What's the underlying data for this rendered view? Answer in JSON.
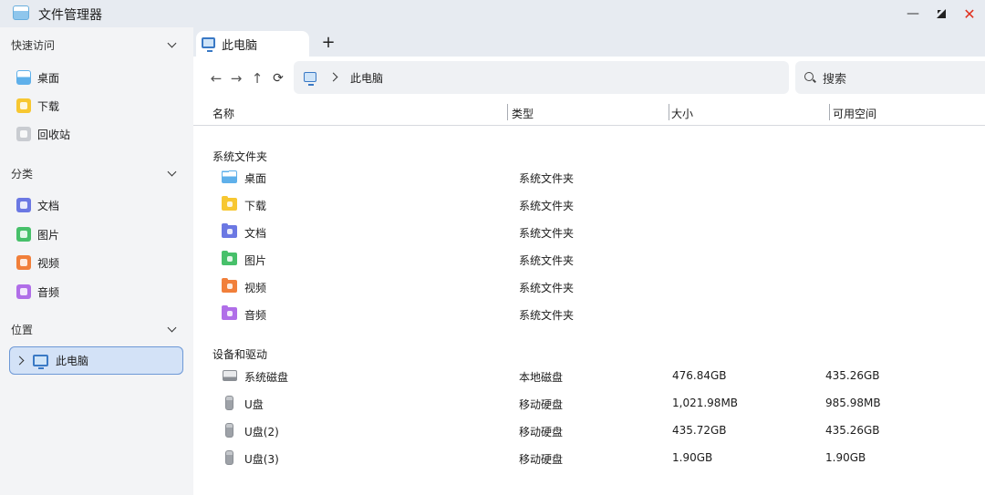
{
  "window": {
    "title": "文件管理器",
    "controls": {
      "minimize": "—",
      "close": "✕"
    }
  },
  "sidebar": {
    "sections": [
      {
        "label": "快速访问",
        "items": [
          {
            "label": "桌面",
            "icon": "desktop-icon"
          },
          {
            "label": "下载",
            "icon": "download-icon"
          },
          {
            "label": "回收站",
            "icon": "recycle-bin-icon"
          }
        ]
      },
      {
        "label": "分类",
        "items": [
          {
            "label": "文档",
            "icon": "document-icon"
          },
          {
            "label": "图片",
            "icon": "picture-icon"
          },
          {
            "label": "视频",
            "icon": "video-icon"
          },
          {
            "label": "音频",
            "icon": "audio-icon"
          }
        ]
      },
      {
        "label": "位置",
        "items": [
          {
            "label": "此电脑",
            "icon": "computer-icon",
            "selected": true
          }
        ]
      }
    ]
  },
  "tabs": [
    {
      "label": "此电脑",
      "icon": "computer-icon"
    }
  ],
  "new_tab_label": "+",
  "toolbar": {
    "back": "←",
    "forward": "→",
    "up": "↑",
    "refresh": "⟳",
    "breadcrumb": [
      "此电脑"
    ],
    "search_placeholder": "搜索"
  },
  "columns": [
    "名称",
    "类型",
    "大小",
    "可用空间"
  ],
  "groups": [
    {
      "title": "系统文件夹",
      "rows": [
        {
          "name": "桌面",
          "type": "系统文件夹",
          "icon": "desktop-folder-icon"
        },
        {
          "name": "下载",
          "type": "系统文件夹",
          "icon": "download-folder-icon"
        },
        {
          "name": "文档",
          "type": "系统文件夹",
          "icon": "document-folder-icon"
        },
        {
          "name": "图片",
          "type": "系统文件夹",
          "icon": "picture-folder-icon"
        },
        {
          "name": "视频",
          "type": "系统文件夹",
          "icon": "video-folder-icon"
        },
        {
          "name": "音频",
          "type": "系统文件夹",
          "icon": "audio-folder-icon"
        }
      ]
    },
    {
      "title": "设备和驱动",
      "rows": [
        {
          "name": "系统磁盘",
          "type": "本地磁盘",
          "size": "476.84GB",
          "free": "435.26GB",
          "icon": "hard-disk-icon"
        },
        {
          "name": "U盘",
          "type": "移动硬盘",
          "size": "1,021.98MB",
          "free": "985.98MB",
          "icon": "usb-drive-icon"
        },
        {
          "name": "U盘(2)",
          "type": "移动硬盘",
          "size": "435.72GB",
          "free": "435.26GB",
          "icon": "usb-drive-icon"
        },
        {
          "name": "U盘(3)",
          "type": "移动硬盘",
          "size": "1.90GB",
          "free": "1.90GB",
          "icon": "usb-drive-icon"
        }
      ]
    }
  ],
  "colors": {
    "accent": "#6d98d6",
    "selected_bg": "#d3e2f7",
    "close": "#e0301e",
    "desktop": "#5fb0ea",
    "download": "#f7c731",
    "document": "#6b78e3",
    "picture": "#47c06a",
    "video": "#f17f3a",
    "audio": "#b06ee8"
  }
}
